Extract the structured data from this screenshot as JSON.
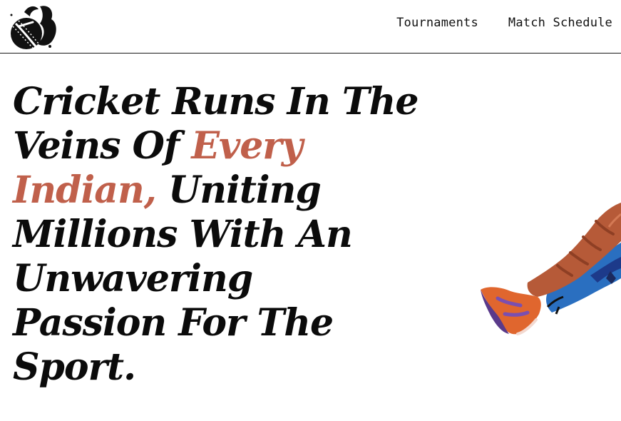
{
  "header": {
    "logo_name": "cricket-ball-logo-icon",
    "nav": [
      {
        "label": "Tournaments"
      },
      {
        "label": "Match Schedule"
      }
    ]
  },
  "hero": {
    "line1": "Cricket Runs In The",
    "line2_plain": "Veins Of ",
    "line2_accent": "Every",
    "line3_accent": "Indian,",
    "line3_plain": " Uniting",
    "line4": "Millions With An",
    "line5": "Unwavering",
    "line6": "Passion For The",
    "line7": "Sport."
  },
  "colors": {
    "accent": "#c0604b",
    "text": "#0b0b0b",
    "background": "#ffffff"
  },
  "illustration": {
    "name": "cricketer-leg-pads-illustration"
  }
}
